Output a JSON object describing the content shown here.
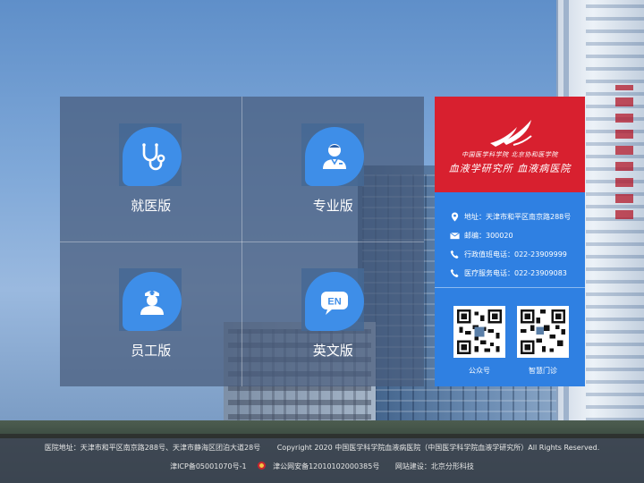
{
  "tiles": [
    {
      "label": "就医版",
      "icon": "stethoscope-icon"
    },
    {
      "label": "专业版",
      "icon": "doctor-icon"
    },
    {
      "label": "员工版",
      "icon": "nurse-icon"
    },
    {
      "label": "英文版",
      "icon": "en-chat-icon",
      "icon_text": "EN"
    }
  ],
  "logo": {
    "line1": "中国医学科学院 北京协和医学院",
    "line2": "血液学研究所 血液病医院"
  },
  "contact": {
    "address": "地址：天津市和平区南京路288号",
    "postcode": "邮编：300020",
    "admin_phone": "行政值班电话：022-23909999",
    "medical_phone": "医疗服务电话：022-23909083"
  },
  "qr": {
    "public_account": "公众号",
    "smart_clinic": "智慧门诊"
  },
  "footer": {
    "address": "医院地址：天津市和平区南京路288号、天津市静海区团泊大道28号",
    "copyright": "Copyright 2020 中国医学科学院血液病医院（中国医学科学院血液学研究所）All Rights Reserved.",
    "icp": "津ICP备05001070号-1",
    "police": "津公网安备12010102000385号",
    "builder": "网站建设：北京分形科技"
  },
  "colors": {
    "accent_blue": "#2f80e2",
    "brand_red": "#d8202f",
    "icon_blue": "#3e8ee8"
  }
}
